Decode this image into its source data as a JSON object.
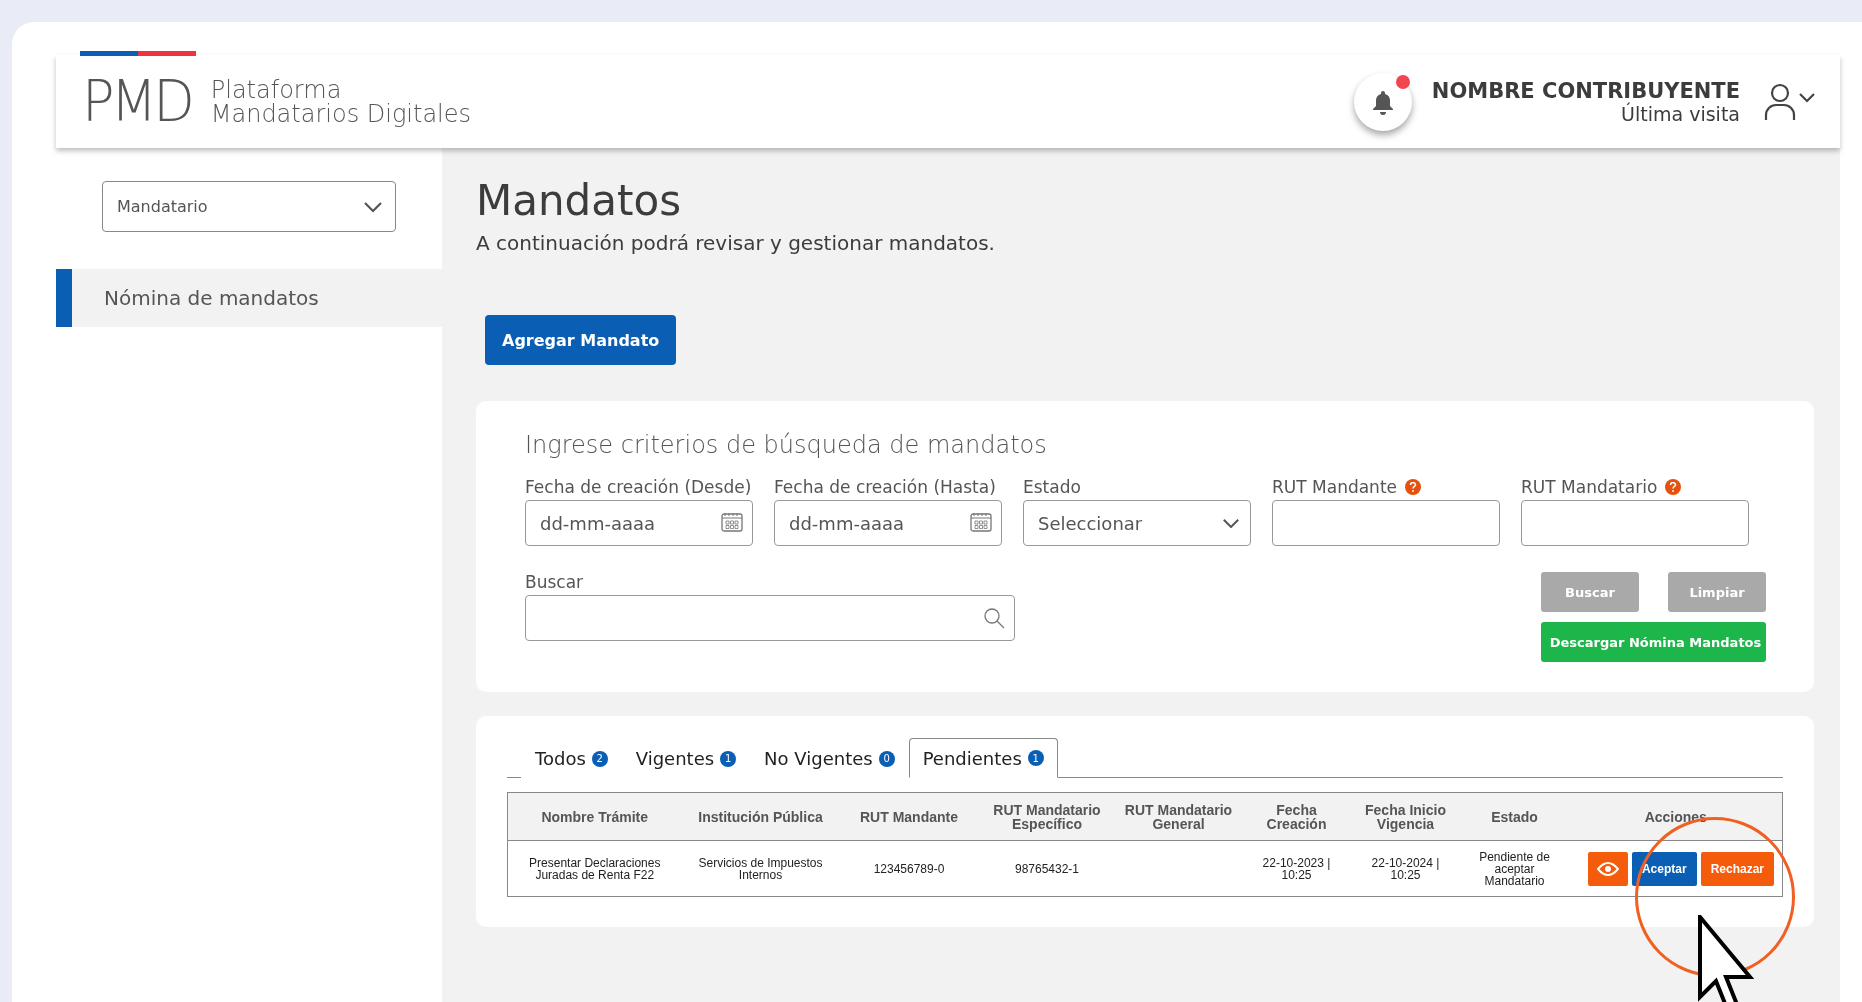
{
  "header": {
    "logo": "PMD",
    "title_lines": [
      "Plataforma",
      "Mandatarios Digitales"
    ],
    "notification_unread": true,
    "user_name": "NOMBRE CONTRIBUYENTE",
    "last_visit": "Última visita"
  },
  "sidebar": {
    "role_select": {
      "value": "Mandatario"
    },
    "items": [
      {
        "label": "Nómina de mandatos",
        "selected": true
      }
    ]
  },
  "page": {
    "title": "Mandatos",
    "subtitle": "A continuación podrá revisar y gestionar mandatos.",
    "add_button": "Agregar Mandato"
  },
  "search": {
    "title": "Ingrese criterios de búsqueda de mandatos",
    "fields": [
      {
        "kind": "date",
        "label": "Fecha de creación (Desde)",
        "placeholder": "dd-mm-aaaa",
        "help": false
      },
      {
        "kind": "date",
        "label": "Fecha de creación (Hasta)",
        "placeholder": "dd-mm-aaaa",
        "help": false
      },
      {
        "kind": "select",
        "label": "Estado",
        "value": "Seleccionar",
        "help": false
      },
      {
        "kind": "text",
        "label": "RUT Mandante",
        "help": true
      },
      {
        "kind": "text",
        "label": "RUT Mandatario",
        "help": true
      }
    ],
    "search_field": {
      "label": "Buscar"
    },
    "buttons": [
      {
        "label": "Buscar",
        "disabled": true
      },
      {
        "label": "Limpiar",
        "disabled": true
      }
    ],
    "download_button": "Descargar Nómina Mandatos"
  },
  "tabs": [
    {
      "label": "Todos",
      "count": "2",
      "selected": false
    },
    {
      "label": "Vigentes",
      "count": "1",
      "selected": false
    },
    {
      "label": "No Vigentes",
      "count": "0",
      "selected": false
    },
    {
      "label": "Pendientes",
      "count": "1",
      "selected": true
    }
  ],
  "table": {
    "columns": [
      "Nombre Trámite",
      "Institución Pública",
      "RUT Mandante",
      "RUT Mandatario Específico",
      "RUT Mandatario General",
      "Fecha Creación",
      "Fecha Inicio Vigencia",
      "Estado",
      "Acciones"
    ],
    "rows": [
      {
        "cells": [
          "Presentar Declaraciones Juradas de Renta F22",
          "Servicios de Impuestos Internos",
          "123456789-0",
          "98765432-1",
          "",
          "22-10-2023 | 10:25",
          "22-10-2024 | 10:25",
          "Pendiente de aceptar Mandatario"
        ],
        "actions": [
          "Aceptar",
          "Rechazar"
        ]
      }
    ]
  }
}
